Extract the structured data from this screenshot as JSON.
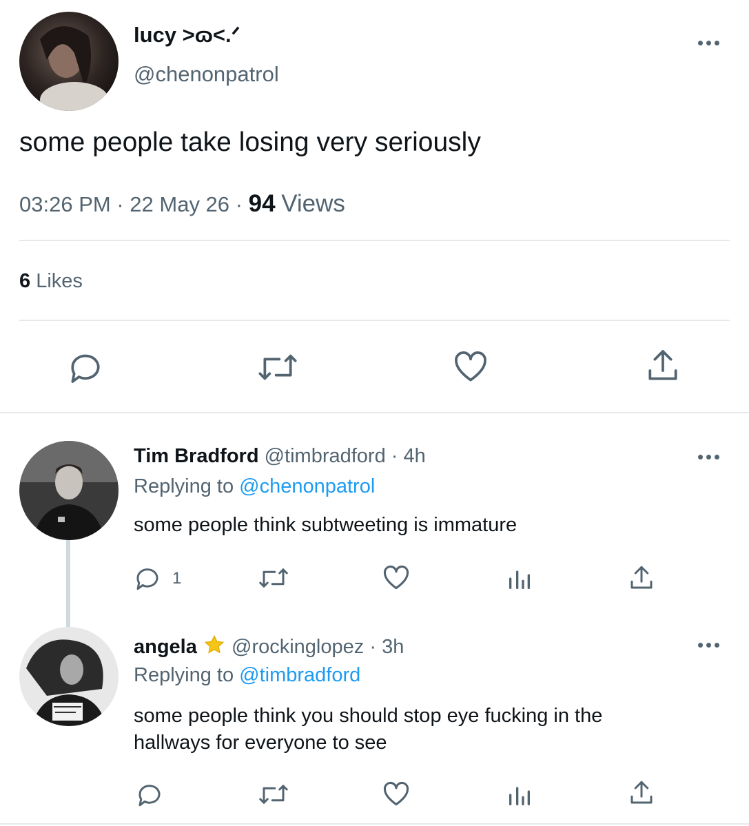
{
  "main_tweet": {
    "display_name": "lucy >ɷ<.ᐟ",
    "handle": "@chenonpatrol",
    "text": "some people take losing very seriously",
    "time": "03:26 PM",
    "date": "22 May 26",
    "views_count": "94",
    "views_label": "Views",
    "likes_count": "6",
    "likes_label": "Likes"
  },
  "replies": [
    {
      "display_name": "Tim Bradford",
      "handle": "@timbradford",
      "time": "4h",
      "replying_prefix": "Replying to",
      "replying_to": "@chenonpatrol",
      "text": "some people think subtweeting is immature",
      "reply_count": "1"
    },
    {
      "display_name": "angela",
      "badge_icon": "star-icon",
      "handle": "@rockinglopez",
      "time": "3h",
      "replying_prefix": "Replying to",
      "replying_to": "@timbradford",
      "text_line1": "some people think you should stop eye fucking in the",
      "text_line2": "hallways for everyone to see",
      "reply_count": ""
    }
  ],
  "separator": "·",
  "colors": {
    "text": "#0f1419",
    "muted": "#536471",
    "link": "#1d9bf0",
    "divider": "#e6e9ec",
    "badge": "#f5c518"
  }
}
